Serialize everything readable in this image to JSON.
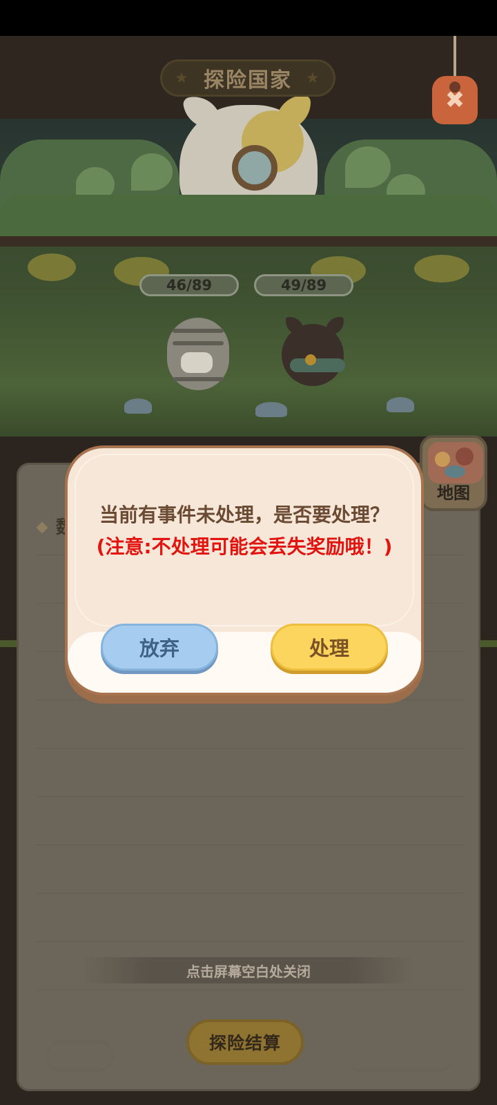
{
  "header": {
    "title": "探险国家",
    "close_icon": "close-tag-icon"
  },
  "battle": {
    "ally_hp": "46/89",
    "enemy_hp": "49/89"
  },
  "panel": {
    "heading": "魏",
    "map_button_label": "地图",
    "hint": "点击屏幕空白处关闭",
    "settle_button_label": "探险结算"
  },
  "dialog": {
    "message": "当前有事件未处理，是否要处理？",
    "warning": "(注意:不处理可能会丢失奖励哦！)",
    "give_up_label": "放弃",
    "handle_label": "处理"
  },
  "colors": {
    "dialog_bg": "#f6e7d8",
    "warning_text": "#e3140f",
    "give_up_button": "#a6cdef",
    "handle_button": "#fcd55f"
  }
}
